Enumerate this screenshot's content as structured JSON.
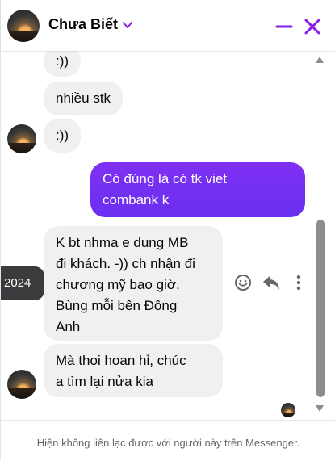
{
  "header": {
    "title": "Chưa Biết"
  },
  "messages": {
    "m1": ":))",
    "m2": "nhiều stk",
    "m3": ":))",
    "m4": "Có đúng là có tk viet\ncombank k",
    "m5": "K bt nhma e dung MB\nđi khách. -)) ch nhận đi\nchương mỹ bao giờ.\nBùng mỗi bên Đông\nAnh",
    "m6": "Mà thoi hoan hỉ, chúc\na tìm lại nửa kia"
  },
  "timeline_pill": "2024",
  "footer": {
    "notice": "Hiện không liên lạc được với người này trên Messenger."
  },
  "colors": {
    "accent": "#8a1ee6",
    "outgoing": "#6d2ff1",
    "incoming": "#f0f0f0"
  },
  "icons": [
    "chevron-down-icon",
    "minimize-icon",
    "close-icon",
    "emoji-icon",
    "reply-icon",
    "more-icon",
    "scroll-up-icon",
    "scroll-down-icon"
  ]
}
